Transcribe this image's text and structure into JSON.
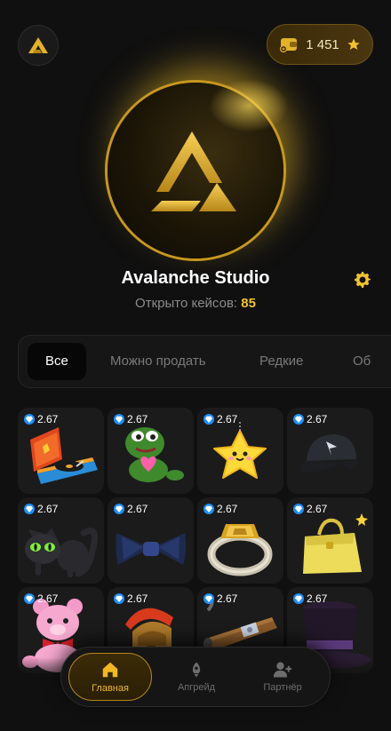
{
  "header": {
    "logo_icon": "avalanche-logo-icon",
    "balance": {
      "icon": "wallet-icon",
      "value": "1 451",
      "currency_icon": "star-icon"
    }
  },
  "profile": {
    "avatar_icon": "avalanche-logo-icon",
    "name": "Avalanche Studio",
    "opened_label": "Открыто кейсов:",
    "opened_count": "85",
    "settings_icon": "gear-icon"
  },
  "filters": {
    "tabs": [
      {
        "label": "Все",
        "active": true
      },
      {
        "label": "Можно продать",
        "active": false
      },
      {
        "label": "Редкие",
        "active": false
      },
      {
        "label": "Об",
        "active": false
      }
    ]
  },
  "items": [
    {
      "price": "2.67",
      "icon": "record-player-icon"
    },
    {
      "price": "2.67",
      "icon": "frog-with-heart-icon"
    },
    {
      "price": "2.67",
      "icon": "star-plush-icon"
    },
    {
      "price": "2.67",
      "icon": "baseball-cap-icon"
    },
    {
      "price": "2.67",
      "icon": "black-cat-icon"
    },
    {
      "price": "2.67",
      "icon": "bow-tie-icon"
    },
    {
      "price": "2.67",
      "icon": "gold-ring-icon"
    },
    {
      "price": "2.67",
      "icon": "handbag-icon"
    },
    {
      "price": "2.67",
      "icon": "pink-teddy-bear-icon"
    },
    {
      "price": "2.67",
      "icon": "spartan-helmet-icon"
    },
    {
      "price": "2.67",
      "icon": "cigar-icon"
    },
    {
      "price": "2.67",
      "icon": "top-hat-icon"
    }
  ],
  "nav": {
    "items": [
      {
        "label": "Главная",
        "icon": "home-icon",
        "active": true
      },
      {
        "label": "Апгрейд",
        "icon": "rocket-icon",
        "active": false
      },
      {
        "label": "Партнёр",
        "icon": "add-user-icon",
        "active": false
      }
    ]
  },
  "colors": {
    "accent": "#f2c230",
    "background": "#101010",
    "card": "#1b1b1b",
    "gem": "#1f8fff"
  }
}
